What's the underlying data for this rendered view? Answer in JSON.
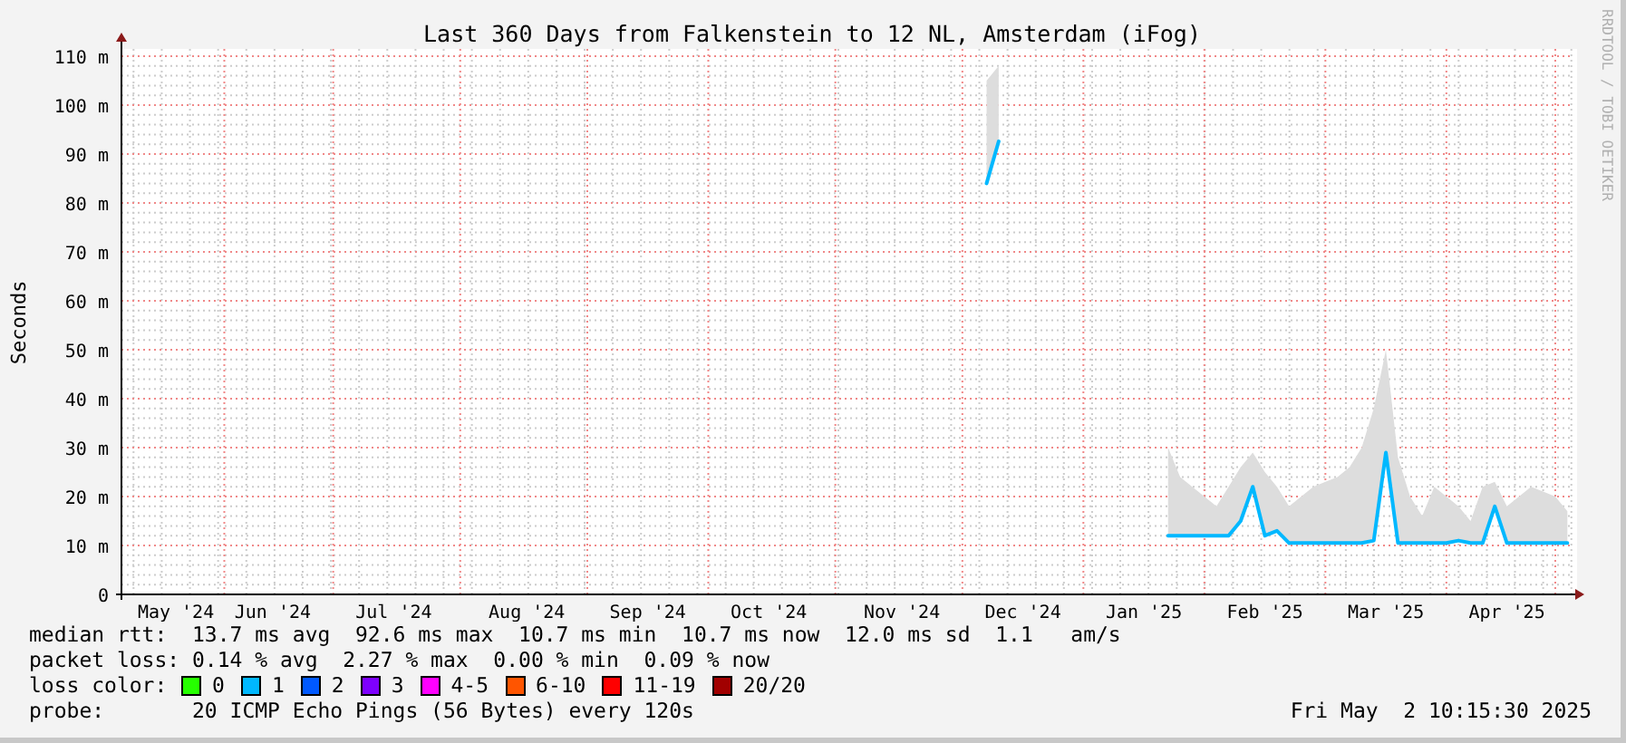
{
  "graph": {
    "side_caption": "RRDTOOL / TOBI OETIKER",
    "chart_data": {
      "type": "line",
      "title": "Last 360 Days from Falkenstein to 12 NL, Amsterdam (iFog)",
      "ylabel": "Seconds",
      "categories": [
        null,
        null,
        null,
        null,
        "May '24",
        null,
        null,
        null,
        null,
        null,
        null,
        null,
        "Jun '24",
        null,
        null,
        null,
        null,
        null,
        null,
        null,
        null,
        null,
        "Jul '24",
        null,
        null,
        null,
        null,
        null,
        null,
        null,
        null,
        null,
        null,
        "Aug '24",
        null,
        null,
        null,
        null,
        null,
        null,
        null,
        null,
        null,
        "Sep '24",
        null,
        null,
        null,
        null,
        null,
        null,
        null,
        null,
        null,
        "Oct '24",
        null,
        null,
        null,
        null,
        null,
        null,
        null,
        null,
        null,
        null,
        "Nov '24",
        null,
        null,
        null,
        null,
        null,
        null,
        null,
        null,
        null,
        "Dec '24",
        null,
        null,
        null,
        null,
        null,
        null,
        null,
        null,
        null,
        "Jan '25",
        null,
        null,
        null,
        null,
        null,
        null,
        null,
        null,
        null,
        "Feb '25",
        null,
        null,
        null,
        null,
        null,
        null,
        null,
        null,
        null,
        "Mar '25",
        null,
        null,
        null,
        null,
        null,
        null,
        null,
        null,
        null,
        "Apr '25",
        null,
        null,
        null,
        null,
        null
      ],
      "series": [
        {
          "type": "area",
          "color": "#dddddd",
          "values": [
            null,
            null,
            null,
            null,
            null,
            null,
            null,
            null,
            null,
            null,
            null,
            null,
            null,
            null,
            null,
            null,
            null,
            null,
            null,
            null,
            null,
            null,
            null,
            null,
            null,
            null,
            null,
            null,
            null,
            null,
            null,
            null,
            null,
            null,
            null,
            null,
            null,
            null,
            null,
            null,
            null,
            null,
            null,
            null,
            null,
            null,
            null,
            null,
            null,
            null,
            null,
            null,
            null,
            null,
            null,
            null,
            null,
            null,
            null,
            null,
            null,
            null,
            null,
            null,
            null,
            null,
            null,
            null,
            null,
            null,
            null,
            105,
            108,
            null,
            null,
            null,
            null,
            null,
            null,
            null,
            null,
            null,
            null,
            null,
            null,
            null,
            30,
            24,
            22,
            20,
            18,
            22,
            26,
            29,
            25,
            22,
            18,
            20,
            22,
            23,
            24,
            26,
            30,
            38,
            50,
            28,
            20,
            16,
            22,
            20,
            18,
            15,
            22,
            23,
            18,
            20,
            22,
            21,
            20,
            17
          ]
        },
        {
          "type": "line",
          "color": "#00b8ff",
          "values": [
            null,
            null,
            null,
            null,
            null,
            null,
            null,
            null,
            null,
            null,
            null,
            null,
            null,
            null,
            null,
            null,
            null,
            null,
            null,
            null,
            null,
            null,
            null,
            null,
            null,
            null,
            null,
            null,
            null,
            null,
            null,
            null,
            null,
            null,
            null,
            null,
            null,
            null,
            null,
            null,
            null,
            null,
            null,
            null,
            null,
            null,
            null,
            null,
            null,
            null,
            null,
            null,
            null,
            null,
            null,
            null,
            null,
            null,
            null,
            null,
            null,
            null,
            null,
            null,
            null,
            null,
            null,
            null,
            null,
            null,
            null,
            84,
            92.6,
            null,
            null,
            null,
            null,
            null,
            null,
            null,
            null,
            null,
            null,
            null,
            null,
            null,
            12,
            12,
            12,
            12,
            12,
            12,
            15,
            22,
            12,
            13,
            10.5,
            10.5,
            10.5,
            10.5,
            10.5,
            10.5,
            10.5,
            11,
            29,
            10.5,
            10.5,
            10.5,
            10.5,
            10.5,
            11,
            10.5,
            10.5,
            18,
            10.5,
            10.5,
            10.5,
            10.5,
            10.5,
            10.5
          ]
        }
      ],
      "ylim": [
        0,
        110
      ],
      "grid": true,
      "yticks": [
        {
          "value": 0,
          "label": "0"
        },
        {
          "value": 10,
          "label": "10 m"
        },
        {
          "value": 20,
          "label": "20 m"
        },
        {
          "value": 30,
          "label": "30 m"
        },
        {
          "value": 40,
          "label": "40 m"
        },
        {
          "value": 50,
          "label": "50 m"
        },
        {
          "value": 60,
          "label": "60 m"
        },
        {
          "value": 70,
          "label": "70 m"
        },
        {
          "value": 80,
          "label": "80 m"
        },
        {
          "value": 90,
          "label": "90 m"
        },
        {
          "value": 100,
          "label": "100 m"
        },
        {
          "value": 110,
          "label": "110 m"
        }
      ]
    }
  },
  "legend": {
    "median_rtt": "median rtt:  13.7 ms avg  92.6 ms max  10.7 ms min  10.7 ms now  12.0 ms sd  1.1   am/s",
    "packet_loss": "packet loss: 0.14 % avg  2.27 % max  0.00 % min  0.09 % now",
    "loss_color_label": "loss color:",
    "loss_colors": [
      {
        "label": "0",
        "color": "#26ff00"
      },
      {
        "label": "1",
        "color": "#00b8ff"
      },
      {
        "label": "2",
        "color": "#0059ff"
      },
      {
        "label": "3",
        "color": "#7e00ff"
      },
      {
        "label": "4-5",
        "color": "#ff00ff"
      },
      {
        "label": "6-10",
        "color": "#ff5500"
      },
      {
        "label": "11-19",
        "color": "#ff0000"
      },
      {
        "label": "20/20",
        "color": "#a10000"
      }
    ],
    "probe": "probe:       20 ICMP Echo Pings (56 Bytes) every 120s",
    "timestamp": "Fri May  2 10:15:30 2025"
  }
}
